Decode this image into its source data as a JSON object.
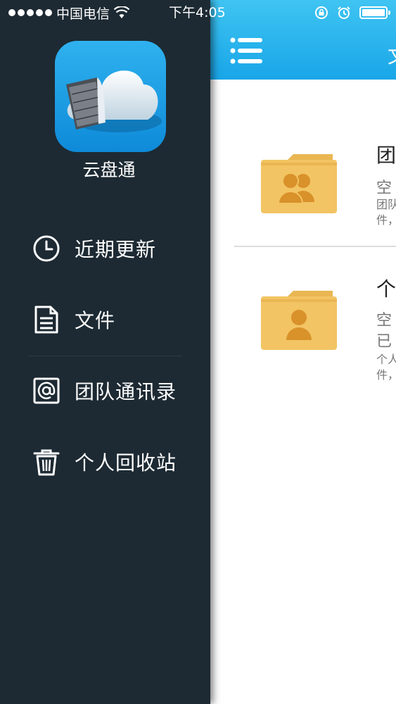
{
  "status_bar": {
    "carrier": "中国电信",
    "time": "下午4:05",
    "icons": [
      "signal-dots",
      "wifi-icon",
      "rotation-lock-icon",
      "alarm-icon",
      "battery-icon"
    ]
  },
  "sidebar": {
    "app_name": "云盘通",
    "items": [
      {
        "label": "近期更新",
        "icon": "clock-icon"
      },
      {
        "label": "文件",
        "icon": "document-icon"
      },
      {
        "label": "团队通讯录",
        "icon": "at-contact-icon"
      },
      {
        "label": "个人回收站",
        "icon": "trash-icon"
      }
    ]
  },
  "main": {
    "nav_title": "文",
    "rows": [
      {
        "title": "团",
        "desc_lines": [
          "空",
          "团队",
          "件，"
        ],
        "icon": "team-folder-icon"
      },
      {
        "title": "个",
        "desc_lines": [
          "空",
          "已",
          "个人",
          "件，"
        ],
        "icon": "personal-folder-icon"
      }
    ]
  },
  "colors": {
    "sidebar_bg": "#1d2a33",
    "nav_bar": "#19a6e8",
    "folder": "#f2c463",
    "folder_figure": "#d9912a"
  }
}
